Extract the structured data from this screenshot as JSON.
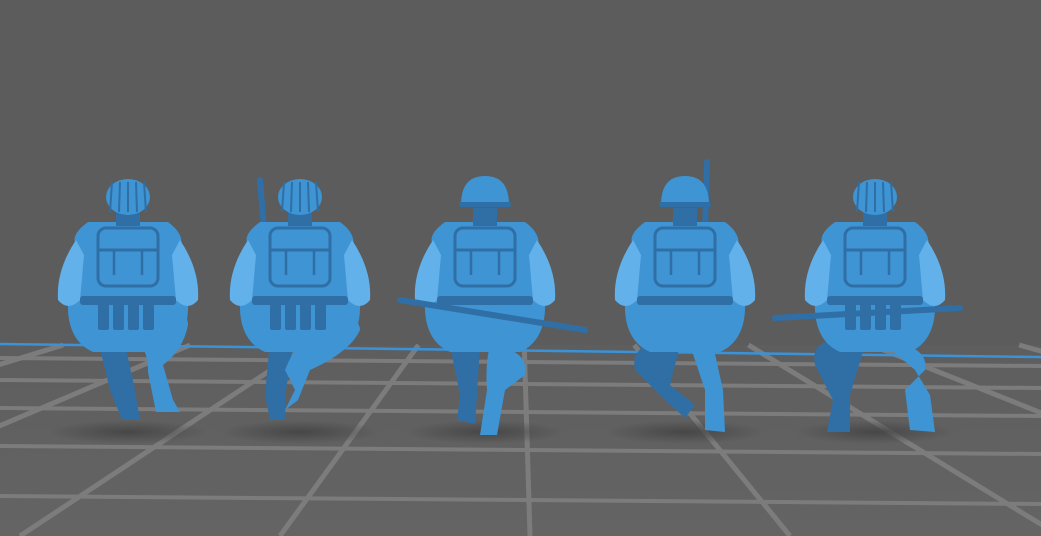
{
  "viewport": {
    "background_color": "#5c5c5c",
    "floor_color": "#606060",
    "grid_color": "#7c7c7c",
    "axis_color": "#3a92d8",
    "model_color": "#3f94d4",
    "model_shade_color": "#2f6fa6",
    "model_highlight_color": "#63b1ea"
  },
  "models": [
    {
      "id": "soldier-1",
      "headgear": "netted-helmet",
      "weapon": "none",
      "leg_pose": "right-knee-raised"
    },
    {
      "id": "soldier-2",
      "headgear": "netted-helmet",
      "weapon": "rifle-over-left-shoulder",
      "leg_pose": "crossed"
    },
    {
      "id": "soldier-3",
      "headgear": "smooth-helmet",
      "weapon": "rifle-across-lap",
      "leg_pose": "feet-together"
    },
    {
      "id": "soldier-4",
      "headgear": "smooth-helmet",
      "weapon": "rifle-over-right-shoulder",
      "leg_pose": "left-leg-extended"
    },
    {
      "id": "soldier-5",
      "headgear": "netted-helmet",
      "weapon": "rifle-across-lap",
      "leg_pose": "feet-apart"
    }
  ]
}
